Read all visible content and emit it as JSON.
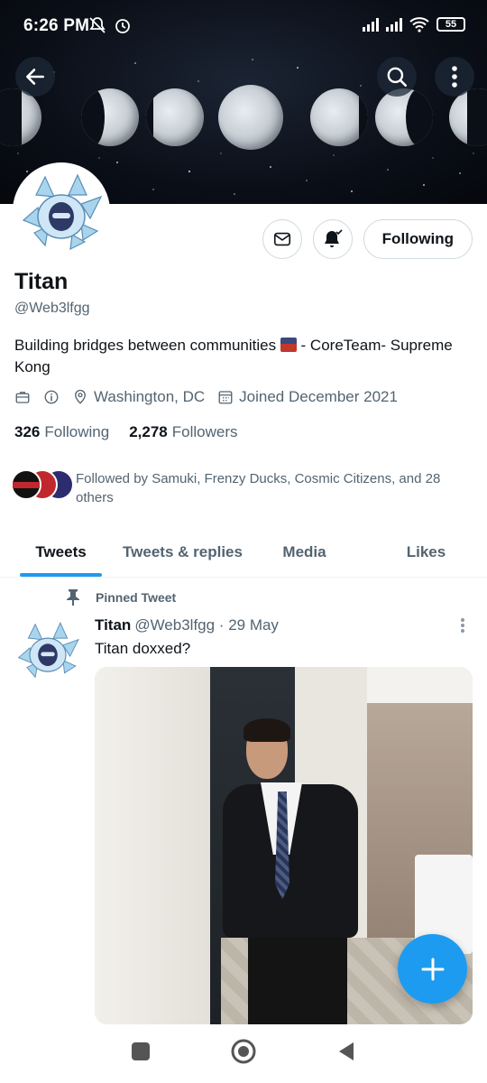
{
  "status_bar": {
    "time": "6:26 PM",
    "battery": "55"
  },
  "header": {
    "back_icon": "arrow-left-icon",
    "search_icon": "search-icon",
    "more_icon": "more-vertical-icon"
  },
  "profile": {
    "name": "Titan",
    "handle": "@Web3lfgg",
    "bio_part1": "Building bridges between communities ",
    "bio_part2": " - CoreTeam- Supreme Kong",
    "location": "Washington, DC",
    "joined": "Joined December 2021",
    "following_count": "326",
    "following_label": "Following",
    "followers_count": "2,278",
    "followers_label": "Followers",
    "followed_by": "Followed by Samuki, Frenzy Ducks, Cosmic Citizens, and 28 others",
    "following_button": "Following"
  },
  "tabs": [
    {
      "label": "Tweets",
      "active": true
    },
    {
      "label": "Tweets & replies",
      "active": false
    },
    {
      "label": "Media",
      "active": false
    },
    {
      "label": "Likes",
      "active": false
    }
  ],
  "tweet": {
    "pinned_label": "Pinned Tweet",
    "author": "Titan",
    "handle_date": "@Web3lfgg · 29 May",
    "text": "Titan doxxed?"
  },
  "colors": {
    "accent": "#1d9bf0",
    "text_primary": "#0f1419",
    "text_secondary": "#536471"
  }
}
